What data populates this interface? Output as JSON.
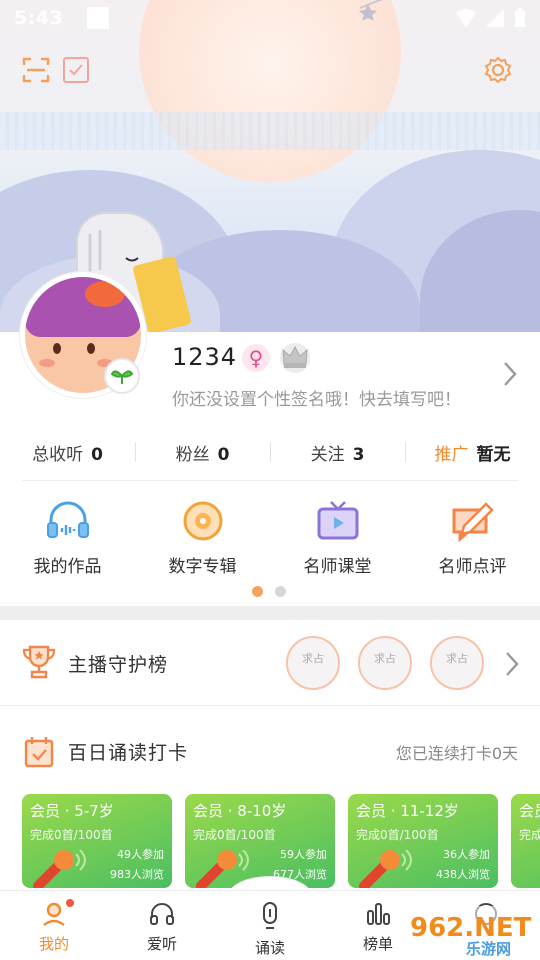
{
  "status_bar": {
    "time": "5:43"
  },
  "profile": {
    "username": "1234",
    "gender_symbol": "♀",
    "signature_placeholder": "你还没设置个性签名哦！快去填写吧！"
  },
  "stats": [
    {
      "label": "总收听",
      "value": "0"
    },
    {
      "label": "粉丝",
      "value": "0"
    },
    {
      "label": "关注",
      "value": "3"
    },
    {
      "label": "推广",
      "value": "暂无"
    }
  ],
  "features": [
    {
      "label": "我的作品",
      "icon": "headphones-icon"
    },
    {
      "label": "数字专辑",
      "icon": "disc-icon"
    },
    {
      "label": "名师课堂",
      "icon": "tv-icon"
    },
    {
      "label": "名师点评",
      "icon": "comment-edit-icon"
    }
  ],
  "guardian": {
    "title": "主播守护榜",
    "slots": [
      "求占",
      "求占",
      "求占"
    ]
  },
  "checkin": {
    "title": "百日诵读打卡",
    "streak_text": "您已连续打卡0天",
    "cards": [
      {
        "title": "会员 · 5-7岁",
        "done": "完成0首/100首",
        "join": "49人参加",
        "view": "983人浏览"
      },
      {
        "title": "会员 · 8-10岁",
        "done": "完成0首/100首",
        "join": "59人参加",
        "view": "677人浏览"
      },
      {
        "title": "会员 · 11-12岁",
        "done": "完成0首/100首",
        "join": "36人参加",
        "view": "438人浏览"
      },
      {
        "title": "会员",
        "done": "完成",
        "join": "",
        "view": ""
      }
    ]
  },
  "nav": [
    {
      "label": "我的",
      "icon": "person-icon",
      "active": true
    },
    {
      "label": "爱听",
      "icon": "headphones-icon"
    },
    {
      "label": "诵读",
      "icon": "microphone-icon"
    },
    {
      "label": "榜单",
      "icon": "ranking-icon"
    },
    {
      "label": "",
      "icon": "more-icon"
    }
  ],
  "watermark": {
    "text": "962.NET",
    "sub": "乐游网"
  },
  "colors": {
    "accent": "#f38a2c",
    "card_green": "#4bbf62",
    "icon_blue": "#4a90e2"
  }
}
